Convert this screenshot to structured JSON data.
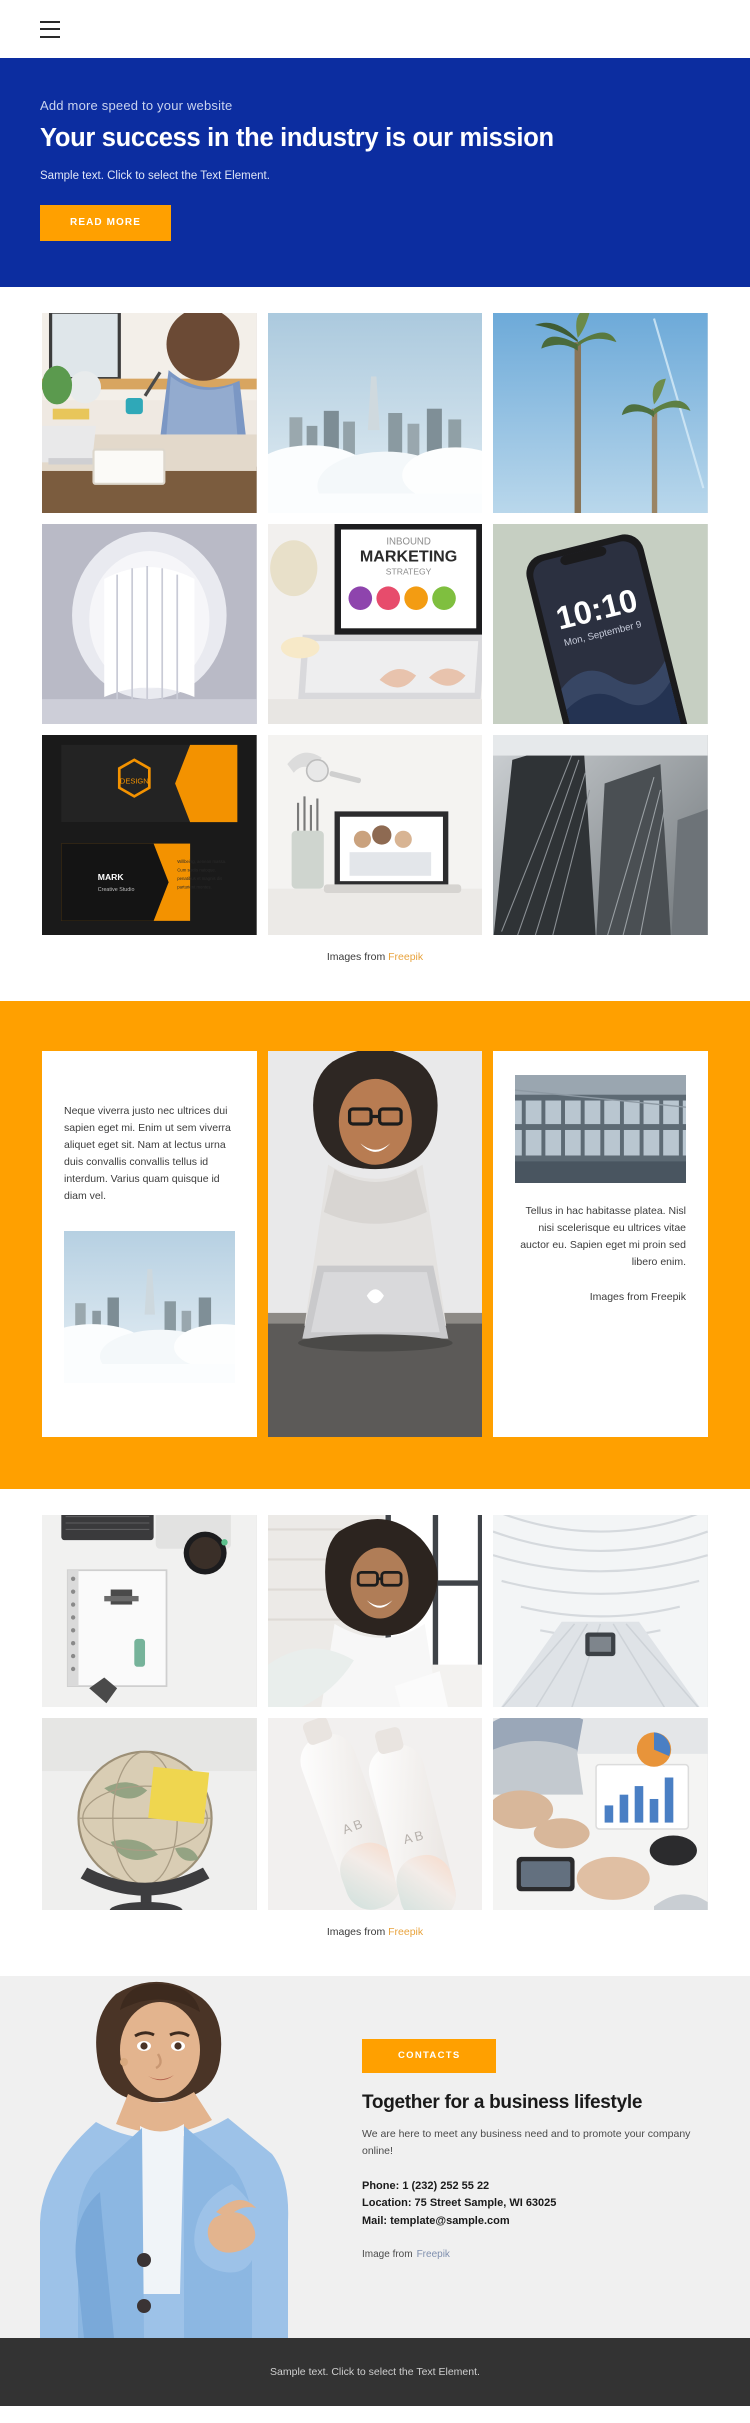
{
  "header": {
    "menu_icon": "hamburger-menu-icon"
  },
  "hero": {
    "eyebrow": "Add more speed to your website",
    "title": "Your success in the industry is our mission",
    "subtitle": "Sample text. Click to select the Text Element.",
    "cta_label": "READ MORE",
    "bg_color": "#0c2da0",
    "accent_color": "#ffa000"
  },
  "gallery_one": {
    "caption_prefix": "Images from ",
    "caption_link": "Freepik",
    "items": [
      {
        "alt": "man writing in notebook at desk with laptop"
      },
      {
        "alt": "skyscrapers above the clouds"
      },
      {
        "alt": "palm trees against blue sky"
      },
      {
        "alt": "white curved architecture interior"
      },
      {
        "alt": "hands typing on laptop with marketing strategy screen"
      },
      {
        "alt": "smartphone showing 10:10 lock screen"
      },
      {
        "alt": "black and orange business card design mockup"
      },
      {
        "alt": "desk with laptop, pencils and lamp"
      },
      {
        "alt": "black and white skyscrapers looking up"
      }
    ]
  },
  "orange_band": {
    "bg_color": "#ffa000",
    "card_left": {
      "text": "Neque viverra justo nec ultrices dui sapien eget mi. Enim ut sem viverra aliquet eget sit. Nam at lectus urna duis convallis convallis tellus id interdum. Varius quam quisque id diam vel.",
      "image_alt": "city towers above clouds"
    },
    "card_middle": {
      "image_alt": "smiling woman working on a laptop"
    },
    "card_right": {
      "image_alt": "modern glass office building facade",
      "text": "Tellus in hac habitasse platea. Nisl nisi scelerisque eu ultrices vitae auctor eu. Sapien eget mi proin sed libero enim.",
      "credit": "Images from Freepik"
    }
  },
  "gallery_two": {
    "caption_prefix": "Images from ",
    "caption_link": "Freepik",
    "items": [
      {
        "alt": "flat lay notebook, laptop and coffee cup"
      },
      {
        "alt": "woman with glasses reading documents by window"
      },
      {
        "alt": "white futuristic corridor"
      },
      {
        "alt": "globe with yellow sticky note"
      },
      {
        "alt": "two cosmetic bottles product shot"
      },
      {
        "alt": "team reviewing charts on a table"
      }
    ]
  },
  "contacts": {
    "bg_color": "#f0f0f0",
    "badge_label": "CONTACTS",
    "heading": "Together for a business lifestyle",
    "lead": "We are here to meet any business need and to promote your company online!",
    "phone": "Phone: 1 (232) 252 55 22",
    "location": "Location: 75 Street Sample, WI 63025",
    "mail": "Mail: template@sample.com",
    "credit_prefix": "Image from",
    "credit_link": "Freepik",
    "photo_alt": "businesswoman in light blue blazer pointing"
  },
  "footer": {
    "text": "Sample text. Click to select the Text Element.",
    "bg_color": "#333333"
  }
}
